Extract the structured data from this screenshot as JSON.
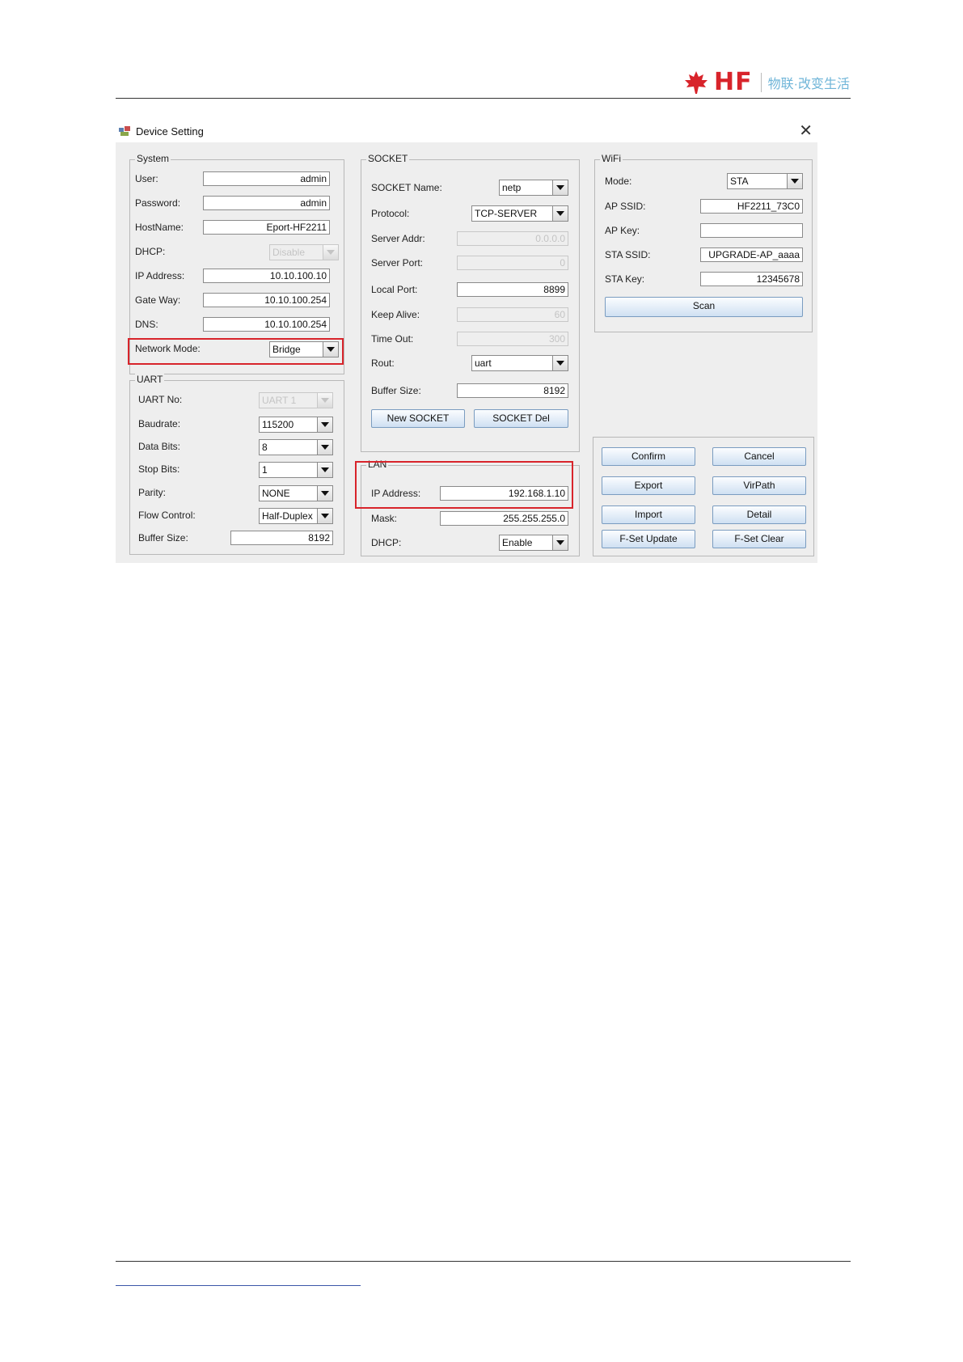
{
  "header": {
    "logo_text": "HF",
    "slogan": "物联·改变生活"
  },
  "window": {
    "title": "Device Setting",
    "close_symbol": "✕"
  },
  "system": {
    "label": "System",
    "user": {
      "label": "User:",
      "value": "admin"
    },
    "password": {
      "label": "Password:",
      "value": "admin"
    },
    "hostname": {
      "label": "HostName:",
      "value": "Eport-HF2211"
    },
    "dhcp": {
      "label": "DHCP:",
      "value": "Disable"
    },
    "ip": {
      "label": "IP Address:",
      "value": "10.10.100.10"
    },
    "gateway": {
      "label": "Gate Way:",
      "value": "10.10.100.254"
    },
    "dns": {
      "label": "DNS:",
      "value": "10.10.100.254"
    },
    "network_mode": {
      "label": "Network Mode:",
      "value": "Bridge"
    }
  },
  "uart": {
    "label": "UART",
    "uart_no": {
      "label": "UART No:",
      "value": "UART 1"
    },
    "baudrate": {
      "label": "Baudrate:",
      "value": "115200"
    },
    "data_bits": {
      "label": "Data Bits:",
      "value": "8"
    },
    "stop_bits": {
      "label": "Stop Bits:",
      "value": "1"
    },
    "parity": {
      "label": "Parity:",
      "value": "NONE"
    },
    "flow_control": {
      "label": "Flow Control:",
      "value": "Half-Duplex"
    },
    "buffer_size": {
      "label": "Buffer Size:",
      "value": "8192"
    }
  },
  "socket": {
    "label": "SOCKET",
    "name": {
      "label": "SOCKET Name:",
      "value": "netp"
    },
    "protocol": {
      "label": "Protocol:",
      "value": "TCP-SERVER"
    },
    "server_addr": {
      "label": "Server Addr:",
      "value": "0.0.0.0"
    },
    "server_port": {
      "label": "Server Port:",
      "value": "0"
    },
    "local_port": {
      "label": "Local Port:",
      "value": "8899"
    },
    "keep_alive": {
      "label": "Keep Alive:",
      "value": "60"
    },
    "time_out": {
      "label": "Time Out:",
      "value": "300"
    },
    "rout": {
      "label": "Rout:",
      "value": "uart"
    },
    "buffer_size": {
      "label": "Buffer Size:",
      "value": "8192"
    },
    "new_button": "New SOCKET",
    "del_button": "SOCKET Del"
  },
  "lan": {
    "label": "LAN",
    "ip": {
      "label": "IP Address:",
      "value": "192.168.1.10"
    },
    "mask": {
      "label": "Mask:",
      "value": "255.255.255.0"
    },
    "dhcp": {
      "label": "DHCP:",
      "value": "Enable"
    }
  },
  "wifi": {
    "label": "WiFi",
    "mode": {
      "label": "Mode:",
      "value": "STA"
    },
    "ap_ssid": {
      "label": "AP SSID:",
      "value": "HF2211_73C0"
    },
    "ap_key": {
      "label": "AP Key:",
      "value": ""
    },
    "sta_ssid": {
      "label": "STA SSID:",
      "value": "UPGRADE-AP_aaaa"
    },
    "sta_key": {
      "label": "STA Key:",
      "value": "12345678"
    },
    "scan_button": "Scan"
  },
  "actions": {
    "confirm": "Confirm",
    "cancel": "Cancel",
    "export": "Export",
    "virpath": "VirPath",
    "import": "Import",
    "detail": "Detail",
    "fset_update": "F-Set Update",
    "fset_clear": "F-Set Clear"
  },
  "colors": {
    "brand_red": "#d8242b",
    "slogan_blue": "#6fb5d8",
    "highlight_red": "#d8242b"
  }
}
